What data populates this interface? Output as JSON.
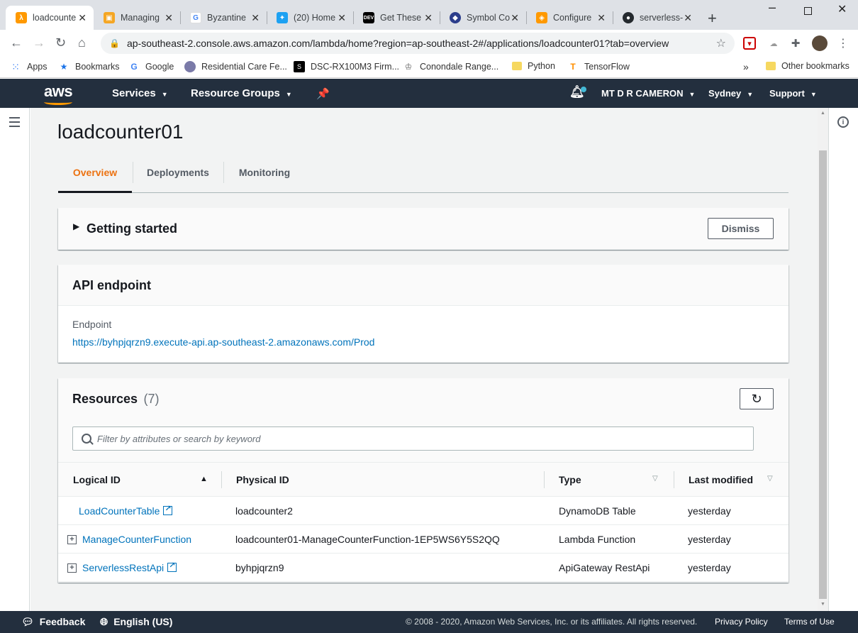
{
  "browser": {
    "tabs": [
      {
        "title": "loadcounte",
        "icon": "aws-icon",
        "color": "#ff9900"
      },
      {
        "title": "Managing",
        "icon": "box-icon",
        "color": "#f5a623"
      },
      {
        "title": "Byzantine",
        "icon": "google-icon",
        "color": "#4285f4"
      },
      {
        "title": "(20) Home",
        "icon": "twitter-icon",
        "color": "#1da1f2"
      },
      {
        "title": "Get These",
        "icon": "dev-icon",
        "color": "#000000"
      },
      {
        "title": "Symbol Co",
        "icon": "symbol-icon",
        "color": "#2c3e8c"
      },
      {
        "title": "Configure",
        "icon": "cube-icon",
        "color": "#ff9900"
      },
      {
        "title": "serverless-",
        "icon": "github-icon",
        "color": "#24292e"
      }
    ],
    "url": "ap-southeast-2.console.aws.amazon.com/lambda/home?region=ap-southeast-2#/applications/loadcounter01?tab=overview",
    "bookmarks": [
      {
        "label": "Apps",
        "icon": "apps-grid-icon"
      },
      {
        "label": "Bookmarks",
        "icon": "star-icon"
      },
      {
        "label": "Google",
        "icon": "google-icon"
      },
      {
        "label": "Residential Care Fe...",
        "icon": "globe-icon"
      },
      {
        "label": "DSC-RX100M3 Firm...",
        "icon": "sony-icon"
      },
      {
        "label": "Conondale Range...",
        "icon": "crest-icon"
      },
      {
        "label": "Python",
        "icon": "folder-icon"
      },
      {
        "label": "TensorFlow",
        "icon": "tensorflow-icon"
      }
    ],
    "other_bookmarks": "Other bookmarks",
    "overflow": "»"
  },
  "aws_header": {
    "logo": "aws",
    "services": "Services",
    "resource_groups": "Resource Groups",
    "account": "MT D R CAMERON",
    "region": "Sydney",
    "support": "Support"
  },
  "page": {
    "title": "loadcounter01",
    "tabs": [
      "Overview",
      "Deployments",
      "Monitoring"
    ],
    "getting_started": {
      "title": "Getting started",
      "dismiss": "Dismiss"
    },
    "api": {
      "title": "API endpoint",
      "endpoint_label": "Endpoint",
      "endpoint_url": "https://byhpjqrzn9.execute-api.ap-southeast-2.amazonaws.com/Prod"
    },
    "resources": {
      "title": "Resources",
      "count": "(7)",
      "search_placeholder": "Filter by attributes or search by keyword",
      "columns": [
        "Logical ID",
        "Physical ID",
        "Type",
        "Last modified"
      ],
      "rows": [
        {
          "logical": "LoadCounterTable",
          "physical": "loadcounter2",
          "type": "DynamoDB Table",
          "modified": "yesterday"
        },
        {
          "logical": "ManageCounterFunction",
          "physical": "loadcounter01-ManageCounterFunction-1EP5WS6Y5S2QQ",
          "type": "Lambda Function",
          "modified": "yesterday"
        },
        {
          "logical": "ServerlessRestApi",
          "physical": "byhpjqrzn9",
          "type": "ApiGateway RestApi",
          "modified": "yesterday"
        }
      ]
    }
  },
  "footer": {
    "feedback": "Feedback",
    "language": "English (US)",
    "copyright": "© 2008 - 2020, Amazon Web Services, Inc. or its affiliates. All rights reserved.",
    "privacy": "Privacy Policy",
    "terms": "Terms of Use"
  },
  "colors": {
    "aws_nav": "#232f3e",
    "accent_orange": "#ec7211",
    "link_blue": "#0073bb"
  }
}
